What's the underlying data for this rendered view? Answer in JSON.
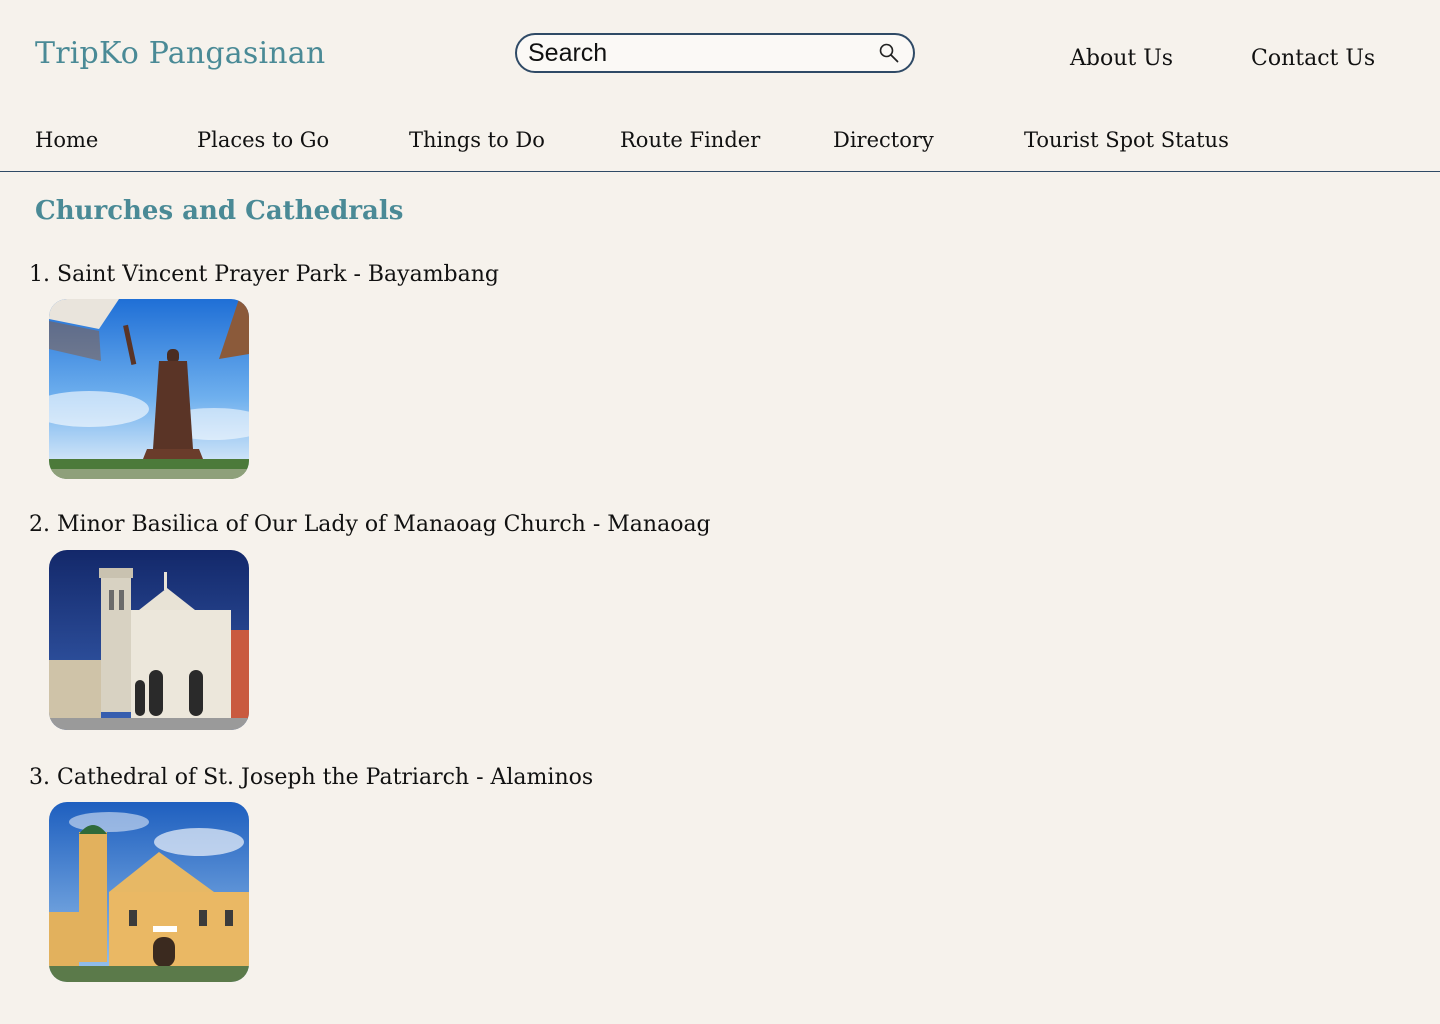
{
  "header": {
    "brand": "TripKo Pangasinan",
    "search_placeholder": "Search",
    "links": [
      "About Us",
      "Contact Us"
    ]
  },
  "nav": {
    "items": [
      "Home",
      "Places to Go",
      "Things to Do",
      "Route Finder",
      "Directory",
      "Tourist Spot Status"
    ]
  },
  "section": {
    "title": "Churches and Cathedrals",
    "items": [
      {
        "number": "1.",
        "title": "Saint Vincent Prayer Park - Bayambang"
      },
      {
        "number": "2.",
        "title": "Minor Basilica of Our Lady of Manaoag Church - Manaoag"
      },
      {
        "number": "3.",
        "title": "Cathedral of St. Joseph the Patriarch - Alaminos"
      }
    ]
  },
  "colors": {
    "background": "#f6f2ec",
    "accent": "#4a8a96",
    "border": "#2f4a66"
  },
  "icons": {
    "search": "search-icon"
  }
}
